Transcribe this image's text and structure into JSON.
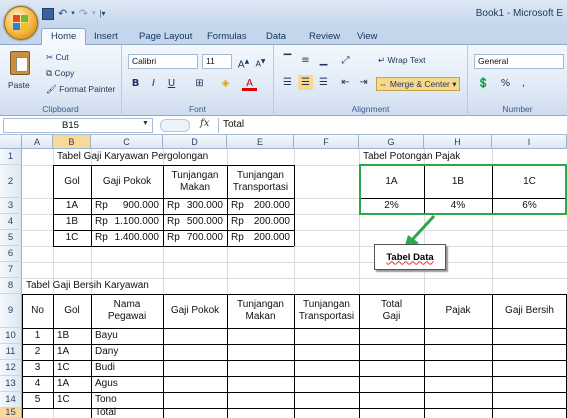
{
  "window": {
    "title": "Book1 - Microsoft E"
  },
  "tabs": [
    "Home",
    "Insert",
    "Page Layout",
    "Formulas",
    "Data",
    "Review",
    "View"
  ],
  "ribbon": {
    "clipboard": {
      "paste": "Paste",
      "cut": "Cut",
      "copy": "Copy",
      "format_painter": "Format Painter",
      "label": "Clipboard"
    },
    "font": {
      "name": "Calibri",
      "size": "11",
      "bold": "B",
      "italic": "I",
      "underline": "U",
      "label": "Font"
    },
    "alignment": {
      "wrap": "Wrap Text",
      "merge": "Merge & Center",
      "label": "Alignment"
    },
    "number": {
      "format": "General",
      "percent": "%",
      "label": "Number"
    }
  },
  "formula_bar": {
    "cell_ref": "B15",
    "fx": "fx",
    "content": "Total"
  },
  "columns": [
    "A",
    "B",
    "C",
    "D",
    "E",
    "F",
    "G",
    "H",
    "I"
  ],
  "rows": [
    "1",
    "2",
    "3",
    "4",
    "5",
    "6",
    "7",
    "8",
    "9",
    "10",
    "11",
    "12",
    "13",
    "14",
    "15"
  ],
  "sheet": {
    "title1": "Tabel Gaji Karyawan Pergolongan",
    "title_pajak": "Tabel Potongan Pajak",
    "title2": "Tabel Gaji Bersih Karyawan",
    "t1_headers": {
      "gol": "Gol",
      "gaji": "Gaji Pokok",
      "tmakan": "Tunjangan Makan",
      "ttrans": "Tunjangan Transportasi"
    },
    "t1_rows": [
      {
        "gol": "1A",
        "gaji_cur": "Rp",
        "gaji": "900.000",
        "makan_cur": "Rp",
        "makan": "300.000",
        "trans_cur": "Rp",
        "trans": "200.000"
      },
      {
        "gol": "1B",
        "gaji_cur": "Rp",
        "gaji": "1.100.000",
        "makan_cur": "Rp",
        "makan": "500.000",
        "trans_cur": "Rp",
        "trans": "200.000"
      },
      {
        "gol": "1C",
        "gaji_cur": "Rp",
        "gaji": "1.400.000",
        "makan_cur": "Rp",
        "makan": "700.000",
        "trans_cur": "Rp",
        "trans": "200.000"
      }
    ],
    "pajak_headers": [
      "1A",
      "1B",
      "1C"
    ],
    "pajak_values": [
      "2%",
      "4%",
      "6%"
    ],
    "callout": "Tabel Data",
    "t2_headers": {
      "no": "No",
      "gol": "Gol",
      "nama": "Nama Pegawai",
      "gaji": "Gaji Pokok",
      "tmakan": "Tunjangan Makan",
      "ttrans": "Tunjangan Transportasi",
      "total": "Total Gaji",
      "pajak": "Pajak",
      "bersih": "Gaji Bersih"
    },
    "t2_rows": [
      {
        "no": "1",
        "gol": "1B",
        "nama": "Bayu"
      },
      {
        "no": "2",
        "gol": "1A",
        "nama": "Dany"
      },
      {
        "no": "3",
        "gol": "1C",
        "nama": "Budi"
      },
      {
        "no": "4",
        "gol": "1A",
        "nama": "Agus"
      },
      {
        "no": "5",
        "gol": "1C",
        "nama": "Tono"
      }
    ],
    "total_label": "Total"
  }
}
